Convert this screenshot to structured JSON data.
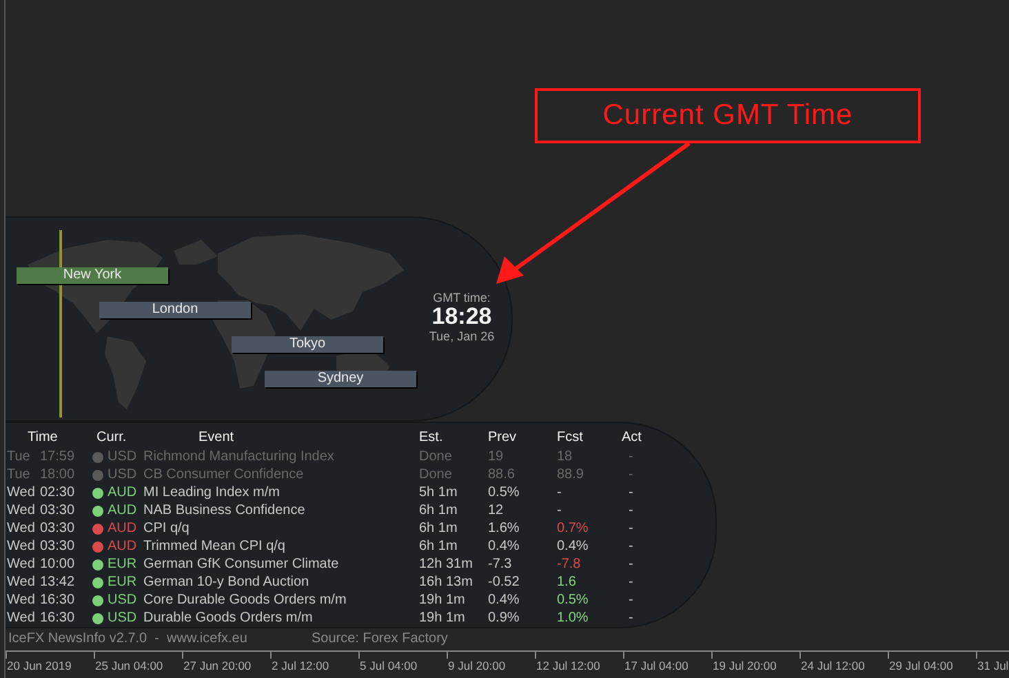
{
  "annotation": {
    "text": "Current GMT Time"
  },
  "sessions": [
    {
      "name": "New York",
      "active": true
    },
    {
      "name": "London",
      "active": false
    },
    {
      "name": "Tokyo",
      "active": false
    },
    {
      "name": "Sydney",
      "active": false
    }
  ],
  "clock": {
    "label": "GMT time:",
    "time": "18:28",
    "date": "Tue, Jan 26"
  },
  "table": {
    "columns": [
      "Time",
      "Curr.",
      "Event",
      "Est.",
      "Prev",
      "Fcst",
      "Act"
    ],
    "rows": [
      {
        "day": "Tue",
        "time": "17:59",
        "currency": "USD",
        "color": "#5a5a5a",
        "event": "Richmond Manufacturing Index",
        "est": "Done",
        "prev": "19",
        "fcst": "18",
        "fcst_worse": false,
        "fcst_better": false,
        "act": "-",
        "done": true
      },
      {
        "day": "Tue",
        "time": "18:00",
        "currency": "USD",
        "color": "#5a5a5a",
        "event": "CB Consumer Confidence",
        "est": "Done",
        "prev": "88.6",
        "fcst": "88.9",
        "fcst_worse": false,
        "fcst_better": false,
        "act": "-",
        "done": true
      },
      {
        "day": "Wed",
        "time": "02:30",
        "currency": "AUD",
        "color": "#7fcf7a",
        "event": "MI Leading Index m/m",
        "est": "5h 1m",
        "prev": "0.5%",
        "fcst": "-",
        "fcst_worse": false,
        "fcst_better": false,
        "act": "-",
        "done": false
      },
      {
        "day": "Wed",
        "time": "03:30",
        "currency": "AUD",
        "color": "#7fcf7a",
        "event": "NAB Business Confidence",
        "est": "6h 1m",
        "prev": "12",
        "fcst": "-",
        "fcst_worse": false,
        "fcst_better": false,
        "act": "-",
        "done": false
      },
      {
        "day": "Wed",
        "time": "03:30",
        "currency": "AUD",
        "color": "#d94a4a",
        "event": "CPI q/q",
        "est": "6h 1m",
        "prev": "1.6%",
        "fcst": "0.7%",
        "fcst_worse": true,
        "fcst_better": false,
        "act": "-",
        "done": false
      },
      {
        "day": "Wed",
        "time": "03:30",
        "currency": "AUD",
        "color": "#d94a4a",
        "event": "Trimmed Mean CPI q/q",
        "est": "6h 1m",
        "prev": "0.4%",
        "fcst": "0.4%",
        "fcst_worse": false,
        "fcst_better": false,
        "act": "-",
        "done": false
      },
      {
        "day": "Wed",
        "time": "10:00",
        "currency": "EUR",
        "color": "#7fcf7a",
        "event": "German GfK Consumer Climate",
        "est": "12h 31m",
        "prev": "-7.3",
        "fcst": "-7.8",
        "fcst_worse": true,
        "fcst_better": false,
        "act": "-",
        "done": false
      },
      {
        "day": "Wed",
        "time": "13:42",
        "currency": "EUR",
        "color": "#7fcf7a",
        "event": "German 10-y Bond Auction",
        "est": "16h 13m",
        "prev": "-0.52",
        "fcst": "1.6",
        "fcst_worse": false,
        "fcst_better": true,
        "act": "-",
        "done": false
      },
      {
        "day": "Wed",
        "time": "16:30",
        "currency": "USD",
        "color": "#7fcf7a",
        "event": "Core Durable Goods Orders m/m",
        "est": "19h 1m",
        "prev": "0.4%",
        "fcst": "0.5%",
        "fcst_worse": false,
        "fcst_better": true,
        "act": "-",
        "done": false
      },
      {
        "day": "Wed",
        "time": "16:30",
        "currency": "USD",
        "color": "#7fcf7a",
        "event": "Durable Goods Orders m/m",
        "est": "19h 1m",
        "prev": "0.9%",
        "fcst": "1.0%",
        "fcst_worse": false,
        "fcst_better": true,
        "act": "-",
        "done": false
      }
    ]
  },
  "footer": {
    "version": "IceFX NewsInfo v2.7.0  -  www.icefx.eu",
    "source": "Source: Forex Factory"
  },
  "time_axis": [
    "20 Jun 2019",
    "25 Jun 04:00",
    "27 Jun 20:00",
    "2 Jul 12:00",
    "5 Jul 04:00",
    "9 Jul 20:00",
    "12 Jul 12:00",
    "17 Jul 04:00",
    "19 Jul 20:00",
    "24 Jul 12:00",
    "29 Jul 04:00",
    "31 Jul"
  ]
}
